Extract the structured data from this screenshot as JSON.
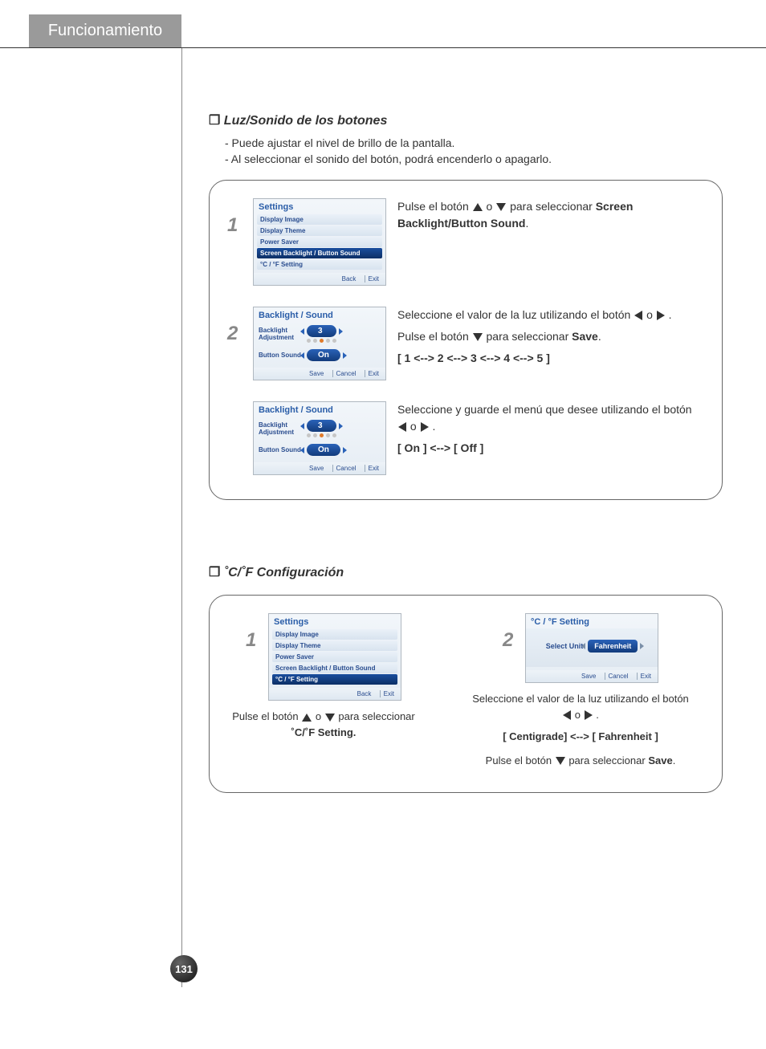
{
  "header": {
    "tab": "Funcionamiento"
  },
  "page_number": "131",
  "section1": {
    "title": "Luz/Sonido de los botones",
    "intro1": "- Puede ajustar el nivel de brillo de la pantalla.",
    "intro2": "- Al seleccionar el sonido del botón, podrá encenderlo o apagarlo.",
    "step1": {
      "num": "1",
      "screen_title": "Settings",
      "items": [
        "Display Image",
        "Display Theme",
        "Power Saver",
        "Screen Backlight / Button Sound",
        "°C / °F Setting"
      ],
      "footer": [
        "Back",
        "Exit"
      ],
      "text_pre": "Pulse el botón ",
      "text_mid": " o ",
      "text_post": " para seleccionar ",
      "bold": "Screen Backlight/Button Sound",
      "period": "."
    },
    "step2": {
      "num": "2",
      "screen_title": "Backlight / Sound",
      "row1_label": "Backlight Adjustment",
      "row1_val": "3",
      "row2_label": "Button Sound",
      "row2_val": "On",
      "footer": [
        "Save",
        "Cancel",
        "Exit"
      ],
      "t1a": "Seleccione el valor de la luz utilizando el botón ",
      "t1b": " o ",
      "t1c": ".",
      "t2a": "Pulse el botón ",
      "t2b": " para seleccionar ",
      "t2bold": "Save",
      "t2c": ".",
      "t3": "[ 1 <--> 2 <--> 3 <--> 4 <--> 5 ]"
    },
    "step3": {
      "screen_title": "Backlight / Sound",
      "row1_label": "Backlight Adjustment",
      "row1_val": "3",
      "row2_label": "Button Sound",
      "row2_val": "On",
      "footer": [
        "Save",
        "Cancel",
        "Exit"
      ],
      "t1a": "Seleccione y guarde el menú que desee utilizando el botón ",
      "t1b": " o ",
      "t1c": " .",
      "t2": "[ On ] <--> [ Off ]"
    }
  },
  "section2": {
    "title": "˚C/˚F Configuración",
    "step1": {
      "num": "1",
      "screen_title": "Settings",
      "items": [
        "Display Image",
        "Display Theme",
        "Power Saver",
        "Screen Backlight / Button Sound",
        "°C / °F Setting"
      ],
      "footer": [
        "Back",
        "Exit"
      ],
      "t1a": "Pulse el botón ",
      "t1b": " o ",
      "t1c": " para seleccionar",
      "bold": "˚C/˚F Setting."
    },
    "step2": {
      "num": "2",
      "screen_title": "°C / °F Setting",
      "row_label": "Select Unit",
      "row_val": "Fahrenheit",
      "footer": [
        "Save",
        "Cancel",
        "Exit"
      ],
      "t1a": "Seleccione el valor de la luz utilizando el botón ",
      "t1b": " o ",
      "t1c": ".",
      "t2": "[ Centigrade] <--> [ Fahrenheit ]",
      "t3a": "Pulse el botón ",
      "t3b": " para seleccionar ",
      "t3bold": "Save",
      "t3c": "."
    }
  }
}
